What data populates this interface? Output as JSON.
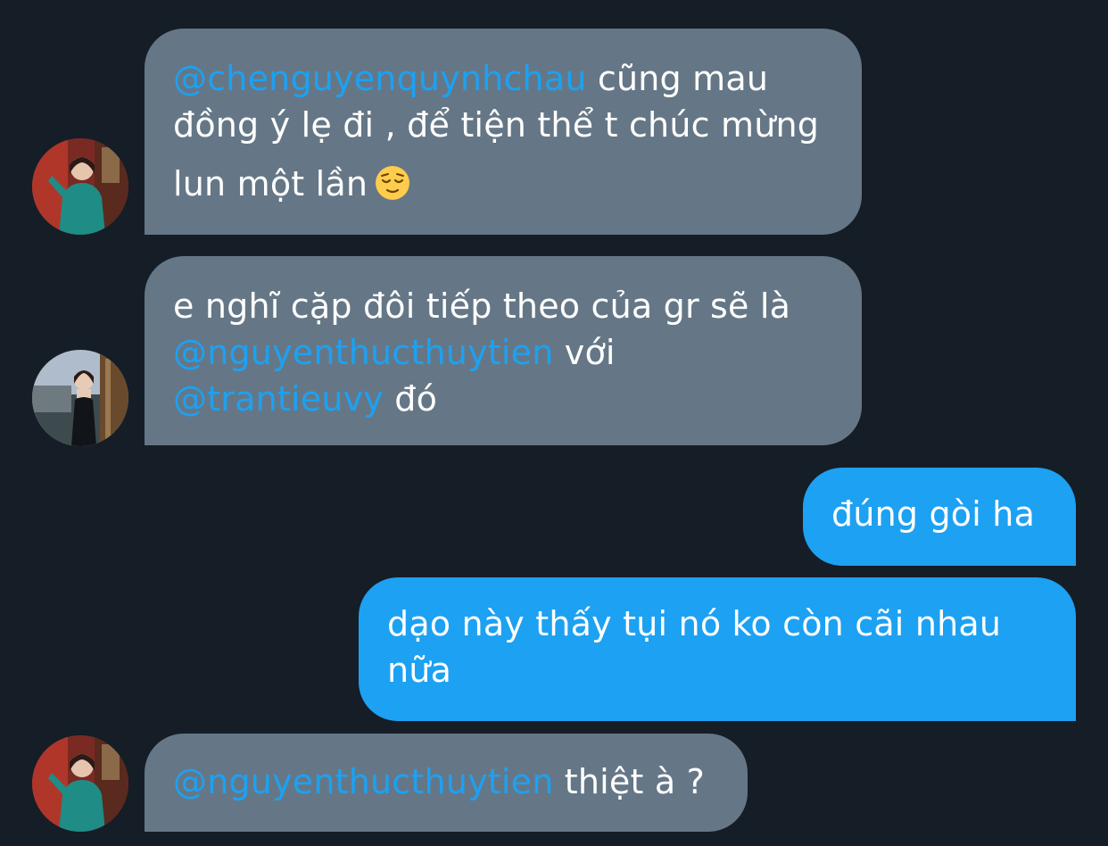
{
  "conversation": {
    "messages": [
      {
        "direction": "incoming",
        "avatar": "avatar-woman-green-dress",
        "lines": [
          {
            "mention": "@chenguyenquynhchau",
            "text": " cũng mau"
          },
          {
            "text": "đồng ý lẹ đi , để tiện thể t chúc mừng"
          },
          {
            "text": "lun một lần",
            "emoji": "relieved-face-emoji"
          }
        ]
      },
      {
        "direction": "incoming",
        "avatar": "avatar-woman-black-dress",
        "lines": [
          {
            "text": "e nghĩ cặp đôi tiếp theo của gr sẽ là"
          },
          {
            "mention": "@nguyenthucthuytien",
            "text": " với"
          },
          {
            "mention": "@trantieuvy",
            "text": " đó"
          }
        ]
      },
      {
        "direction": "outgoing",
        "lines": [
          {
            "text": "đúng gòi ha"
          }
        ]
      },
      {
        "direction": "outgoing",
        "lines": [
          {
            "text": "dạo này thấy tụi nó ko còn cãi nhau"
          },
          {
            "text": "nữa"
          }
        ]
      },
      {
        "direction": "incoming",
        "avatar": "avatar-woman-green-dress",
        "lines": [
          {
            "mention": "@nguyenthucthuytien",
            "text": " thiệt à ?"
          }
        ]
      }
    ]
  },
  "colors": {
    "background": "#151d27",
    "incoming_bubble": "#657786",
    "outgoing_bubble": "#1da1f2",
    "mention": "#1da1f2",
    "text": "#ffffff"
  }
}
